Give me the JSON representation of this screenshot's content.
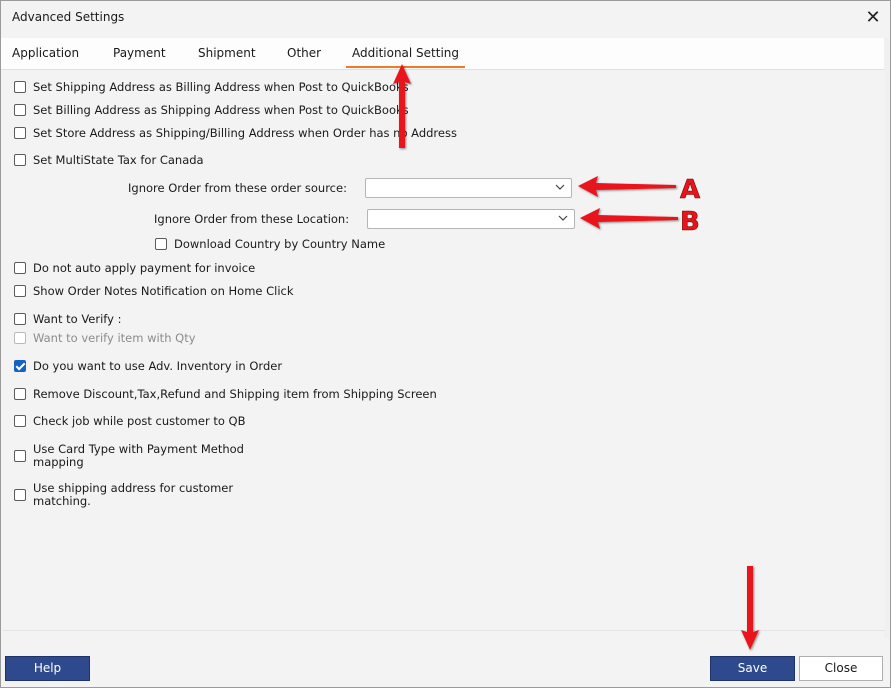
{
  "window": {
    "title": "Advanced Settings",
    "close_glyph": "✕"
  },
  "tabs": [
    {
      "label": "Application"
    },
    {
      "label": "Payment"
    },
    {
      "label": "Shipment"
    },
    {
      "label": "Other"
    },
    {
      "label": "Additional Setting",
      "active": true
    }
  ],
  "options": {
    "ship_as_bill": {
      "label": "Set Shipping Address as Billing Address when Post to QuickBooks",
      "checked": false
    },
    "bill_as_ship": {
      "label": "Set Billing Address as Shipping Address when Post to QuickBooks",
      "checked": false
    },
    "store_addr": {
      "label": "Set Store Address as Shipping/Billing Address when Order has no Address",
      "checked": false
    },
    "multistate": {
      "label": "Set MultiState Tax for Canada",
      "checked": false
    },
    "ignore_source": {
      "label": "Ignore Order from these order source:",
      "value": ""
    },
    "ignore_location": {
      "label": "Ignore Order from these  Location:",
      "value": ""
    },
    "download_country": {
      "label": "Download Country by Country Name",
      "checked": false
    },
    "no_auto_payment": {
      "label": "Do not auto apply payment for invoice",
      "checked": false
    },
    "order_notes": {
      "label": "Show Order Notes Notification on Home Click",
      "checked": false
    },
    "want_verify": {
      "label": "Want to Verify :",
      "checked": false
    },
    "verify_qty": {
      "label": "Want to verify item with Qty",
      "checked": false,
      "disabled": true
    },
    "adv_inventory": {
      "label": "Do you want to use Adv. Inventory in Order",
      "checked": true
    },
    "remove_discount": {
      "label": "Remove Discount,Tax,Refund and Shipping item from Shipping Screen",
      "checked": false
    },
    "check_job": {
      "label": "Check job while post customer to QB",
      "checked": false
    },
    "card_type": {
      "label": "Use Card Type with Payment Method mapping",
      "checked": false
    },
    "ship_matching": {
      "label": "Use shipping address for customer matching.",
      "checked": false
    }
  },
  "footer": {
    "help": "Help",
    "save": "Save",
    "close": "Close"
  },
  "annotations": {
    "marker_a": "A",
    "marker_b": "B",
    "arrow_color": "#e8141c"
  },
  "colors": {
    "accent_tab": "#f07a2b",
    "button_blue": "#2e4a8c",
    "check_blue": "#1463c4"
  }
}
